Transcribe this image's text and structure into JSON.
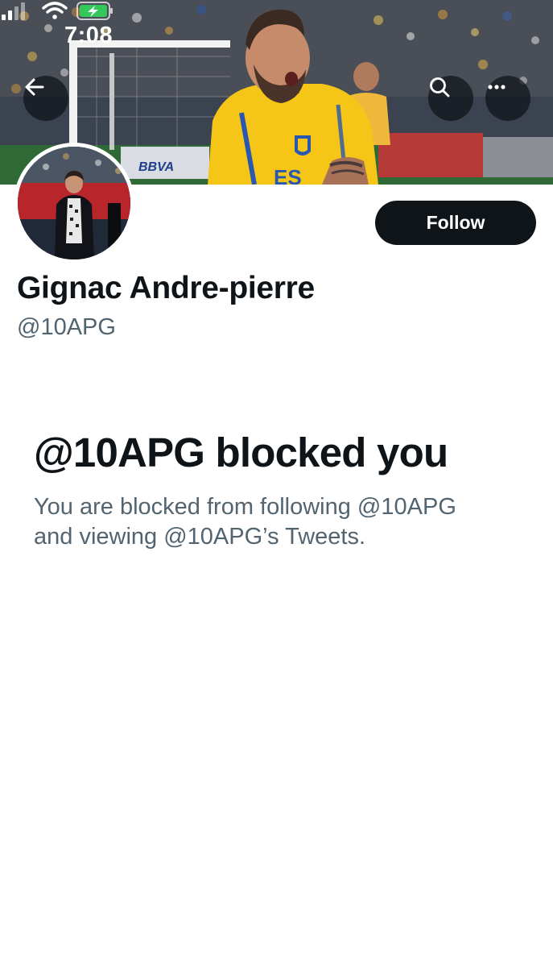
{
  "status_bar": {
    "time": "7:08",
    "icons": [
      "cellular-signal-icon",
      "wifi-icon",
      "battery-charging-icon"
    ]
  },
  "header": {
    "buttons": [
      "back-arrow-icon",
      "search-icon",
      "more-options-icon"
    ]
  },
  "profile": {
    "display_name": "Gignac Andre-pierre",
    "handle": "@10APG",
    "follow_label": "Follow"
  },
  "blocked": {
    "title": "@10APG blocked you",
    "line1": "You are blocked from following @10APG",
    "line2": "and viewing @10APG’s Tweets."
  },
  "colors": {
    "primary_text": "#0f1419",
    "secondary_text": "#536471",
    "follow_button": "#0f1419",
    "battery_charging": "#34c759",
    "jersey": "#f5c518"
  }
}
